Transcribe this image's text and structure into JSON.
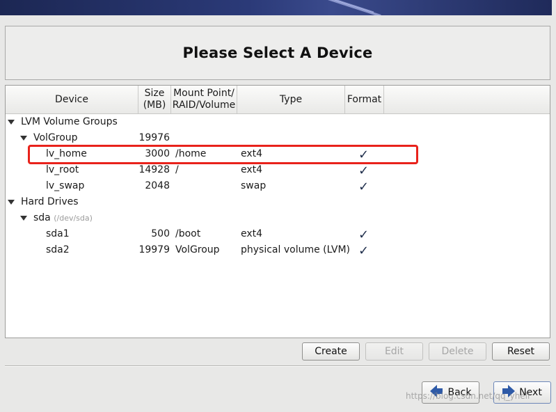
{
  "page": {
    "title": "Please Select A Device"
  },
  "table": {
    "headers": {
      "device": "Device",
      "size_line1": "Size",
      "size_line2": "(MB)",
      "mount_line1": "Mount Point/",
      "mount_line2": "RAID/Volume",
      "type": "Type",
      "format": "Format"
    },
    "rows": [
      {
        "device": "LVM Volume Groups",
        "level": 0,
        "expander": true
      },
      {
        "device": "VolGroup",
        "level": 1,
        "expander": true,
        "size": "19976"
      },
      {
        "device": "lv_home",
        "level": 2,
        "size": "3000",
        "mount": "/home",
        "type": "ext4",
        "format": true
      },
      {
        "device": "lv_root",
        "level": 2,
        "size": "14928",
        "mount": "/",
        "type": "ext4",
        "format": true
      },
      {
        "device": "lv_swap",
        "level": 2,
        "size": "2048",
        "mount": "",
        "type": "swap",
        "format": true
      },
      {
        "device": "Hard Drives",
        "level": 0,
        "expander": true
      },
      {
        "device": "sda",
        "sub": "(/dev/sda)",
        "level": 1,
        "expander": true
      },
      {
        "device": "sda1",
        "level": 2,
        "size": "500",
        "mount": "/boot",
        "type": "ext4",
        "format": true
      },
      {
        "device": "sda2",
        "level": 2,
        "size": "19979",
        "mount": "VolGroup",
        "type": "physical volume (LVM)",
        "format": true
      }
    ],
    "check_glyph": "✓"
  },
  "actions": {
    "create": "Create",
    "edit": "Edit",
    "delete": "Delete",
    "reset": "Reset"
  },
  "nav": {
    "back": "Back",
    "next": "Next"
  },
  "watermark": "https://blog.csdn.net/qq_yhell"
}
